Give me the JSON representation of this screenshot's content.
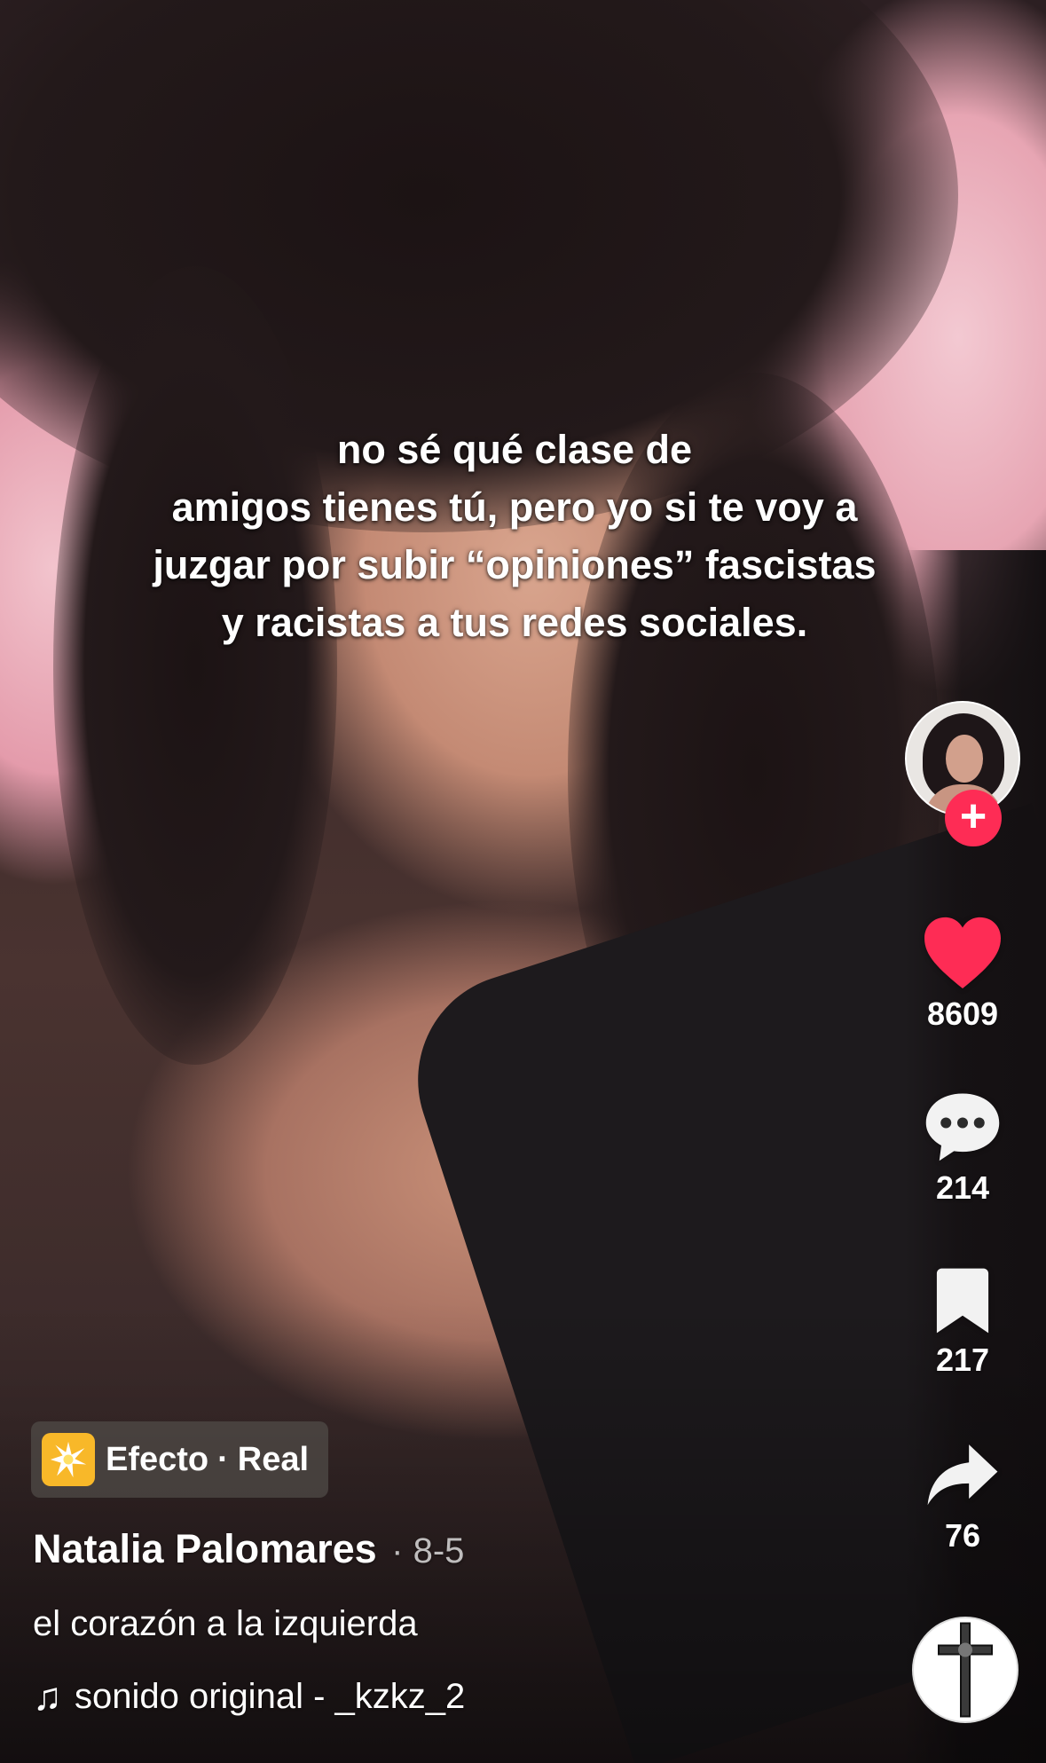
{
  "video": {
    "caption_lines": [
      "no sé qué clase de",
      "amigos tienes tú, pero yo si te voy a",
      "juzgar por subir “opiniones” fascistas",
      "y racistas a tus redes sociales."
    ]
  },
  "actions": {
    "likes": "8609",
    "comments": "214",
    "saves": "217",
    "shares": "76",
    "like_color": "#fe2c55",
    "follow_color": "#fe2c55"
  },
  "effect": {
    "label": "Efecto",
    "separator": "·",
    "name": "Real",
    "icon": "sparkle-burst-icon"
  },
  "author": {
    "name": "Natalia Palomares",
    "date": "· 8-5"
  },
  "description": "el corazón a la izquierda",
  "music": {
    "icon": "music-note-icon",
    "track": "sonido original - _kzkz_2"
  }
}
